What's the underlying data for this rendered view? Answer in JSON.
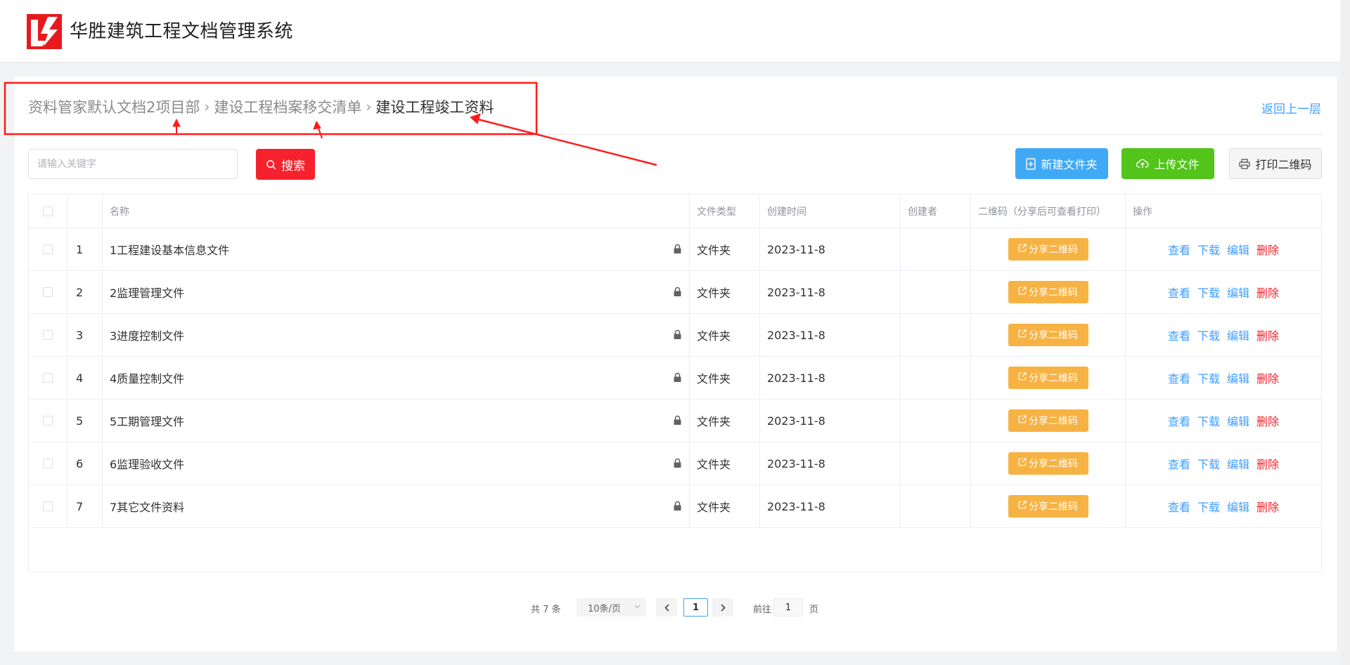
{
  "app": {
    "title": "华胜建筑工程文档管理系统"
  },
  "breadcrumb": {
    "items": [
      "资料管家默认文档2项目部",
      "建设工程档案移交清单",
      "建设工程竣工资料"
    ],
    "back_label": "返回上一层"
  },
  "toolbar": {
    "search_placeholder": "请输入关键字",
    "search_label": "搜索",
    "new_folder_label": "新建文件夹",
    "upload_label": "上传文件",
    "print_label": "打印二维码"
  },
  "table": {
    "headers": [
      "名称",
      "文件类型",
      "创建时间",
      "创建者",
      "二维码（分享后可查看打印）",
      "操作"
    ],
    "rows": [
      {
        "index": "1",
        "name": "1工程建设基本信息文件",
        "type": "文件夹",
        "created": "2023-11-8",
        "creator": ""
      },
      {
        "index": "2",
        "name": "2监理管理文件",
        "type": "文件夹",
        "created": "2023-11-8",
        "creator": ""
      },
      {
        "index": "3",
        "name": "3进度控制文件",
        "type": "文件夹",
        "created": "2023-11-8",
        "creator": ""
      },
      {
        "index": "4",
        "name": "4质量控制文件",
        "type": "文件夹",
        "created": "2023-11-8",
        "creator": ""
      },
      {
        "index": "5",
        "name": "5工期管理文件",
        "type": "文件夹",
        "created": "2023-11-8",
        "creator": ""
      },
      {
        "index": "6",
        "name": "6监理验收文件",
        "type": "文件夹",
        "created": "2023-11-8",
        "creator": ""
      },
      {
        "index": "7",
        "name": "7其它文件资料",
        "type": "文件夹",
        "created": "2023-11-8",
        "creator": ""
      }
    ],
    "qr_button_label": "分享二维码",
    "ops": {
      "view": "查看",
      "download": "下载",
      "edit": "编辑",
      "delete": "删除"
    }
  },
  "pagination": {
    "total_text": "共 7 条",
    "page_size": "10条/页",
    "current_page": "1",
    "goto_label": "前往",
    "goto_value": "1",
    "goto_unit": "页"
  },
  "colors": {
    "brand_red": "#f5222d",
    "primary_blue": "#409eff",
    "new_folder_blue": "#3fa9f5",
    "upload_green": "#52c41a",
    "qr_orange": "#f7b244",
    "annotation_red": "#ff1a1a"
  },
  "icons": {
    "logo": "brand-logo-icon",
    "search": "search-icon",
    "new_folder": "file-plus-icon",
    "upload": "cloud-upload-icon",
    "print": "printer-icon",
    "lock": "lock-icon",
    "share": "share-icon"
  }
}
